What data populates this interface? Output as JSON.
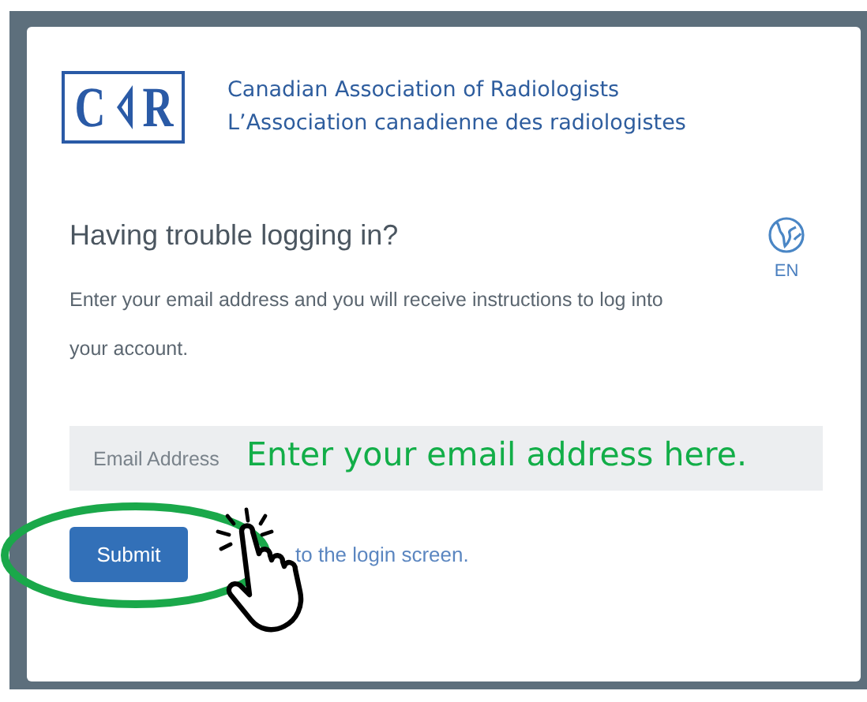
{
  "logo": {
    "letter_left": "C",
    "letter_right": "R",
    "org_name_en": "Canadian Association of Radiologists",
    "org_name_fr": "L’Association canadienne des radiologistes"
  },
  "language": {
    "label": "EN"
  },
  "heading": "Having trouble logging in?",
  "instructions": "Enter your email address and you will receive instructions to log into your account.",
  "email_field": {
    "placeholder": "Email Address"
  },
  "submit_button": "Submit",
  "login_link": "to the login screen.",
  "annotations": [
    {
      "kind": "text",
      "text": "Enter your email address here."
    },
    {
      "kind": "ellipse"
    },
    {
      "kind": "hand"
    }
  ]
}
